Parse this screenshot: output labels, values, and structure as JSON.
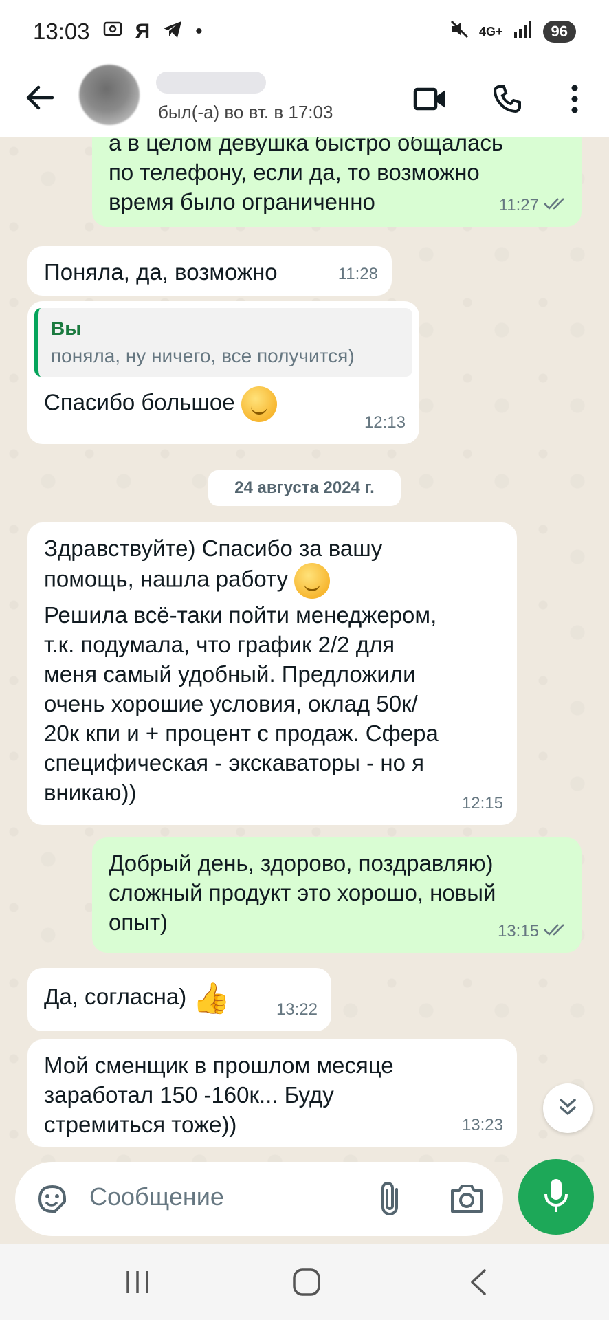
{
  "status_bar": {
    "time": "13:03",
    "ya": "Я",
    "dot": "•",
    "network": "4G+",
    "battery": "96"
  },
  "header": {
    "last_seen": "был(-а) во вт. в 17:03"
  },
  "messages": [
    {
      "dir": "out",
      "lines": [
        "а в целом девушка быстро общалась",
        "по телефону, если да, то возможно",
        "время было ограниченно"
      ],
      "time": "11:27"
    },
    {
      "dir": "in",
      "text": "Поняла, да, возможно",
      "time": "11:28"
    },
    {
      "dir": "in",
      "quote_author": "Вы",
      "quote_text": "поняла, ну ничего, все получится)",
      "text": "Спасибо большое",
      "time": "12:13"
    },
    {
      "dir": "in",
      "lines": [
        "Здравствуйте) Спасибо за вашу",
        "помощь, нашла работу",
        "Решила всё-таки пойти менеджером,",
        "т.к. подумала, что график 2/2 для",
        "меня самый удобный. Предложили",
        "очень хорошие условия, оклад 50к/",
        "20к кпи и + процент с продаж. Сфера",
        "специфическая - экскаваторы - но я",
        "вникаю))"
      ],
      "time": "12:15"
    },
    {
      "dir": "out",
      "lines": [
        "Добрый день, здорово, поздравляю)",
        "сложный продукт это хорошо, новый",
        "опыт)"
      ],
      "time": "13:15"
    },
    {
      "dir": "in",
      "text": "Да, согласна)",
      "time": "13:22"
    },
    {
      "dir": "in",
      "lines": [
        "Мой сменщик в прошлом месяце",
        "заработал 150 -160к... Буду",
        "стремиться тоже))"
      ],
      "time": "13:23"
    }
  ],
  "date_divider": "24 августа 2024 г.",
  "input": {
    "placeholder": "Сообщение"
  },
  "colors": {
    "outgoing": "#d9fdd3",
    "incoming": "#ffffff",
    "accent": "#1da858",
    "background": "#efe9df"
  },
  "icons": [
    "back-arrow-icon",
    "video-call-icon",
    "phone-icon",
    "more-vert-icon",
    "sticker-icon",
    "attach-icon",
    "camera-icon",
    "mic-icon",
    "double-check-icon",
    "chevrons-down-icon"
  ]
}
